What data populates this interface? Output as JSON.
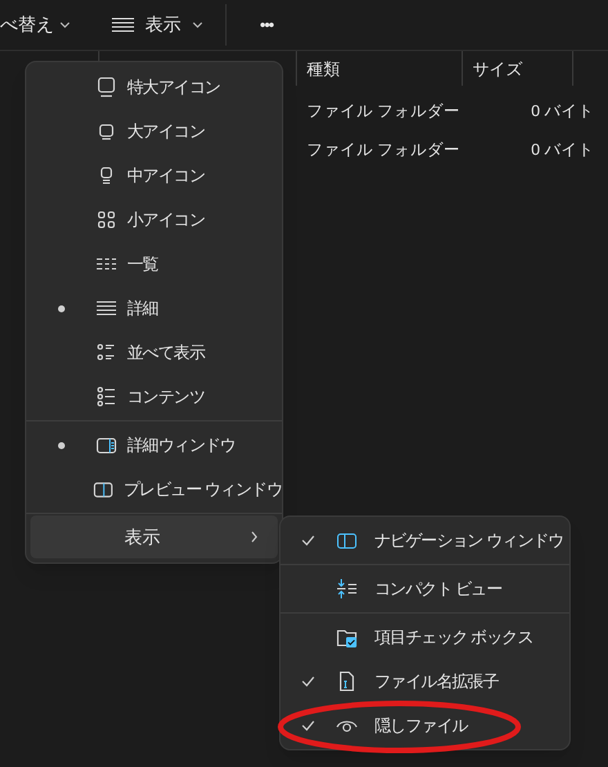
{
  "toolbar": {
    "sort_button": {
      "label": "べ替え"
    },
    "view_button": {
      "label": "表示"
    },
    "more_button": {
      "label": "•••"
    }
  },
  "table": {
    "columns": [
      "種類",
      "サイズ"
    ],
    "rows": [
      [
        "ファイル フォルダー",
        "0 バイト"
      ],
      [
        "ファイル フォルダー",
        "0 バイト"
      ]
    ]
  },
  "view_menu": {
    "items": [
      {
        "kind": "item",
        "label": "特大アイコン",
        "selected": false
      },
      {
        "kind": "item",
        "label": "大アイコン",
        "selected": false
      },
      {
        "kind": "item",
        "label": "中アイコン",
        "selected": false
      },
      {
        "kind": "item",
        "label": "小アイコン",
        "selected": false
      },
      {
        "kind": "item",
        "label": "一覧",
        "selected": false
      },
      {
        "kind": "item",
        "label": "詳細",
        "selected": true
      },
      {
        "kind": "item",
        "label": "並べて表示",
        "selected": false
      },
      {
        "kind": "item",
        "label": "コンテンツ",
        "selected": false
      },
      {
        "kind": "divider"
      },
      {
        "kind": "item",
        "label": "詳細ウィンドウ",
        "selected": true
      },
      {
        "kind": "item",
        "label": "プレビュー ウィンドウ",
        "selected": false
      },
      {
        "kind": "divider"
      },
      {
        "kind": "submenu",
        "label": "表示",
        "selected": true
      }
    ]
  },
  "show_submenu": {
    "items": [
      {
        "kind": "item",
        "label": "ナビゲーション ウィンドウ",
        "checked": true
      },
      {
        "kind": "divider"
      },
      {
        "kind": "item",
        "label": "コンパクト ビュー",
        "checked": false
      },
      {
        "kind": "divider"
      },
      {
        "kind": "item",
        "label": "項目チェック ボックス",
        "checked": false
      },
      {
        "kind": "item",
        "label": "ファイル名拡張子",
        "checked": true
      },
      {
        "kind": "item",
        "label": "隠しファイル",
        "checked": true
      }
    ]
  }
}
